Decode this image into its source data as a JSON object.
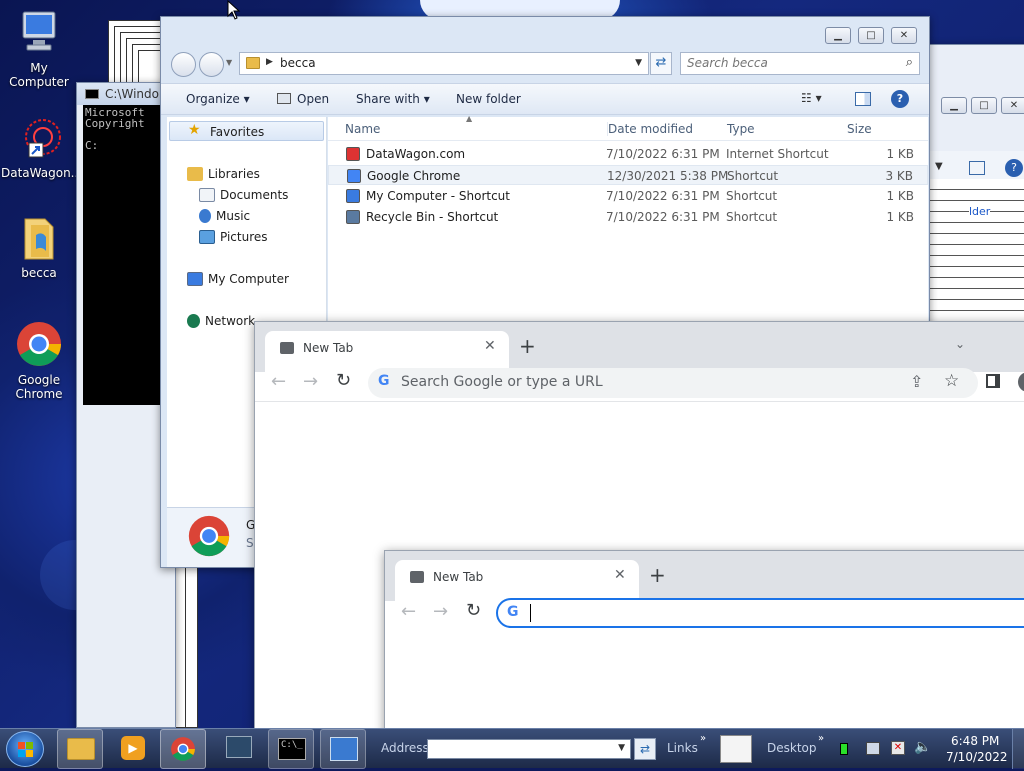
{
  "desktop": {
    "icons": [
      {
        "label": "My Computer"
      },
      {
        "label": "DataWagon..."
      },
      {
        "label": "becca"
      },
      {
        "label": "Google Chrome"
      }
    ]
  },
  "cmd": {
    "title": "C:\\Windo",
    "line1": "Microsoft",
    "line2": "Copyright",
    "prompt": "C:"
  },
  "explorer": {
    "path": "becca",
    "search_placeholder": "Search becca",
    "toolbar": {
      "organize": "Organize",
      "open": "Open",
      "share": "Share with",
      "new_folder": "New folder"
    },
    "nav": {
      "favorites": "Favorites",
      "libraries": "Libraries",
      "documents": "Documents",
      "music": "Music",
      "pictures": "Pictures",
      "computer": "My Computer",
      "network": "Network"
    },
    "columns": {
      "name": "Name",
      "date": "Date modified",
      "type": "Type",
      "size": "Size"
    },
    "files": [
      {
        "name": "DataWagon.com",
        "date": "7/10/2022 6:31 PM",
        "type": "Internet Shortcut",
        "size": "1 KB"
      },
      {
        "name": "Google Chrome",
        "date": "12/30/2021 5:38 PM",
        "type": "Shortcut",
        "size": "3 KB"
      },
      {
        "name": "My Computer - Shortcut",
        "date": "7/10/2022 6:31 PM",
        "type": "Shortcut",
        "size": "1 KB"
      },
      {
        "name": "Recycle Bin - Shortcut",
        "date": "7/10/2022 6:31 PM",
        "type": "Shortcut",
        "size": "1 KB"
      }
    ],
    "details": {
      "line1": "G",
      "line2": "Sh"
    }
  },
  "back_explorer": {
    "folder_label": "lder"
  },
  "chrome1": {
    "tab_title": "New Tab",
    "omnibox_placeholder": "Search Google or type a URL"
  },
  "chrome2": {
    "tab_title": "New Tab",
    "omnibox_value": ""
  },
  "taskbar": {
    "address_label": "Address",
    "address_value": "",
    "links_label": "Links",
    "desktop_label": "Desktop",
    "time": "6:48 PM",
    "date": "7/10/2022"
  }
}
